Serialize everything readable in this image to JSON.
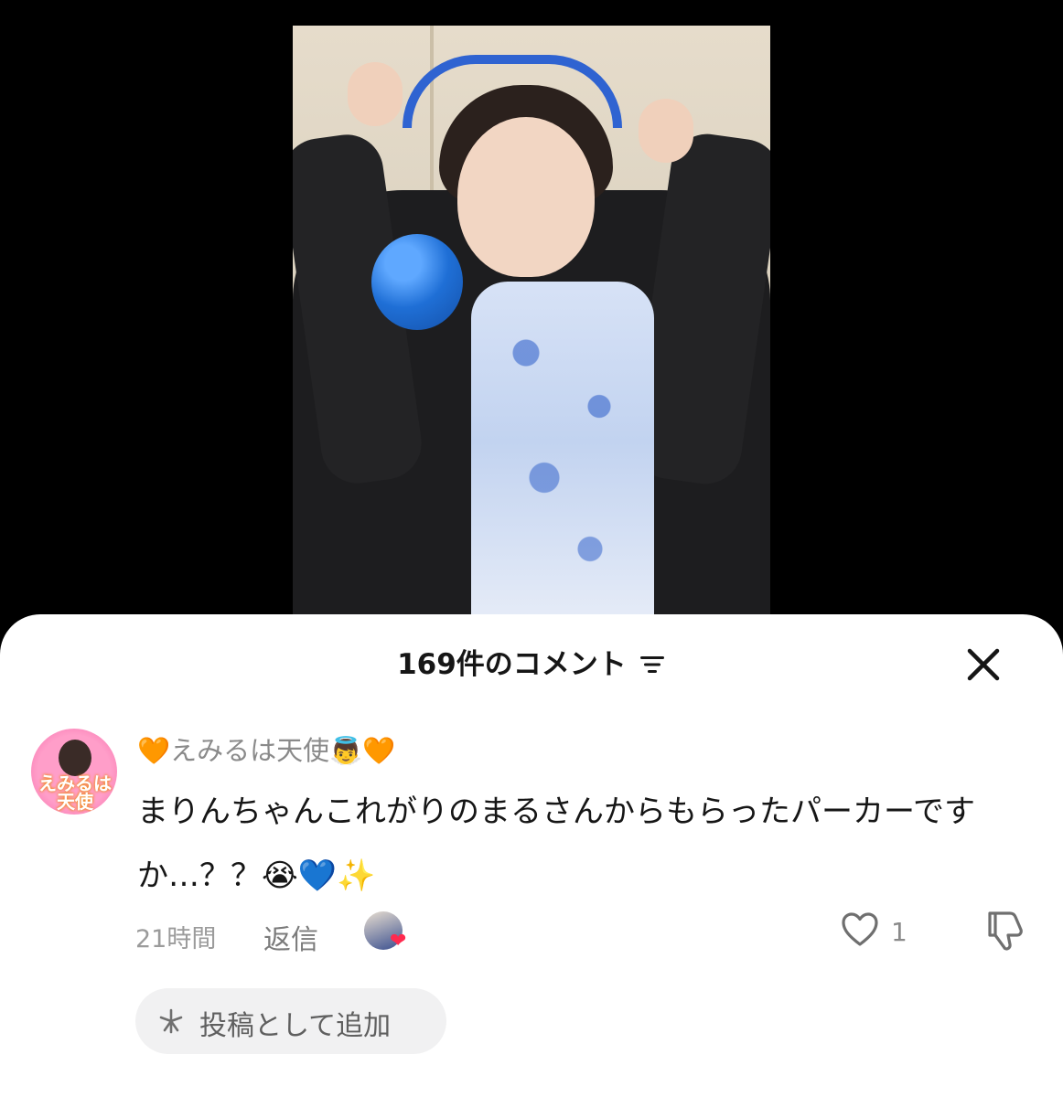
{
  "header": {
    "comment_count_title": "169件のコメント",
    "sort_icon": "sort-icon",
    "close_icon": "close-icon"
  },
  "comment": {
    "avatar_text": "えみるは天使",
    "username": "🧡えみるは天使👼🧡",
    "text": "まりんちゃんこれがりのまるさんからもらったパーカーですか…？？😭💙✨",
    "timestamp": "21時間",
    "reply_label": "返信",
    "like_count": "1"
  },
  "actions": {
    "add_as_post_label": "投稿として追加"
  },
  "colors": {
    "accent_heart": "#ff2a4f",
    "sheet_bg": "#ffffff",
    "muted_text": "#8a8a8a"
  }
}
